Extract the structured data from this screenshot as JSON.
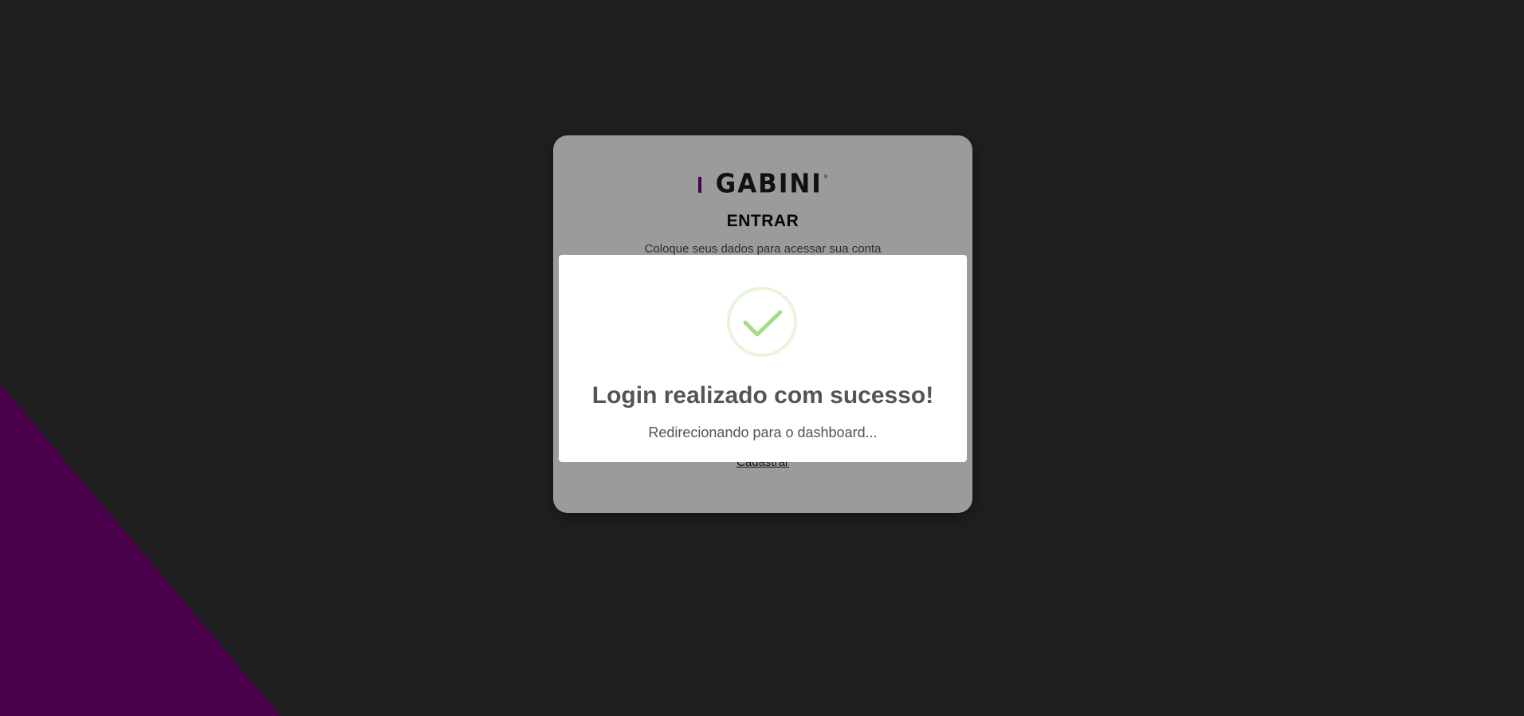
{
  "brand": {
    "name": "GABINI",
    "registered_mark": "®",
    "accent_color": "#4b004b"
  },
  "login": {
    "title": "ENTRAR",
    "subtitle": "Coloque seus dados para acessar sua conta",
    "register_link": "Cadastrar"
  },
  "alert": {
    "icon": "success-check-icon",
    "title": "Login realizado com sucesso!",
    "text": "Redirecionando para o dashboard...",
    "icon_color": "#a5dc86"
  },
  "colors": {
    "background": "#1f1f1f",
    "card": "#9b9b9b",
    "decor_purple": "#4b004b"
  }
}
